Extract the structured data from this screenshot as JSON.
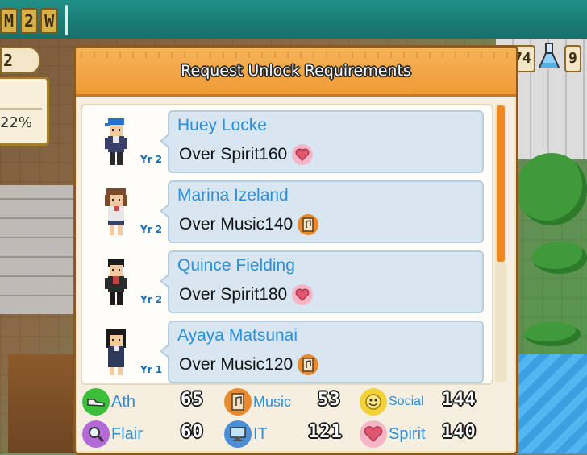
{
  "hud": {
    "date_parts": [
      "M",
      "2",
      "W"
    ],
    "left_level": "2",
    "left_percent": "22%",
    "right_value_a": "74",
    "right_value_b": "9"
  },
  "dialog": {
    "title": "Request Unlock Requirements",
    "students": [
      {
        "name": "Huey Locke",
        "year": "Yr 2",
        "requirement": "Over Spirit160",
        "stat_icon": "heart-icon"
      },
      {
        "name": "Marina Izeland",
        "year": "Yr 2",
        "requirement": "Over Music140",
        "stat_icon": "music-icon"
      },
      {
        "name": "Quince Fielding",
        "year": "Yr 2",
        "requirement": "Over Spirit180",
        "stat_icon": "heart-icon"
      },
      {
        "name": "Ayaya Matsunai",
        "year": "Yr 1",
        "requirement": "Over Music120",
        "stat_icon": "music-icon"
      }
    ],
    "scroll_fraction": 0.57
  },
  "stats": {
    "ath": {
      "label": "Ath",
      "value": "65"
    },
    "music": {
      "label": "Music",
      "value": "53"
    },
    "social": {
      "label": "Social",
      "value": "144"
    },
    "flair": {
      "label": "Flair",
      "value": "60"
    },
    "it": {
      "label": "IT",
      "value": "121"
    },
    "spirit": {
      "label": "Spirit",
      "value": "140"
    }
  },
  "colors": {
    "header_orange": "#ef9a35",
    "name_blue": "#2a8fd8",
    "bubble_blue": "#d7e6f1",
    "scroll_orange": "#ef8a22"
  }
}
